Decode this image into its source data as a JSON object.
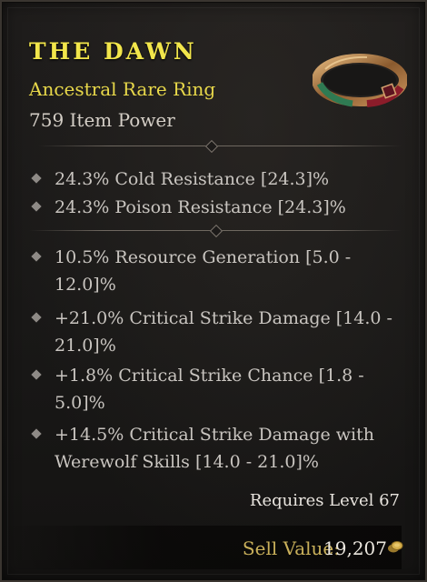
{
  "item": {
    "name": "THE DAWN",
    "type": "Ancestral Rare Ring",
    "power": "759 Item Power"
  },
  "icons": {
    "item": "ring-icon",
    "bullet": "diamond-bullet-icon",
    "currency": "gold-coin-icon"
  },
  "implicit_affixes": [
    "24.3% Cold Resistance [24.3]%",
    "24.3% Poison Resistance [24.3]%"
  ],
  "affixes": [
    {
      "line1": "10.5% Resource Generation [5.0 -",
      "line2": "12.0]%"
    },
    {
      "line1": "+21.0% Critical Strike Damage [14.0 -",
      "line2": "21.0]%"
    },
    {
      "line1": "+1.8% Critical Strike Chance [1.8 -",
      "line2": "5.0]%"
    },
    {
      "line1": "+14.5% Critical Strike Damage with",
      "line2": "Werewolf Skills [14.0 - 21.0]%"
    }
  ],
  "requirement": "Requires Level 67",
  "sell": {
    "label": "Sell Value:",
    "value": "19,207"
  },
  "colors": {
    "rare_title": "#f2e64b",
    "rare_type": "#e8d84a",
    "stat_text": "#c9c5c0",
    "sell_label": "#c9b05a"
  }
}
